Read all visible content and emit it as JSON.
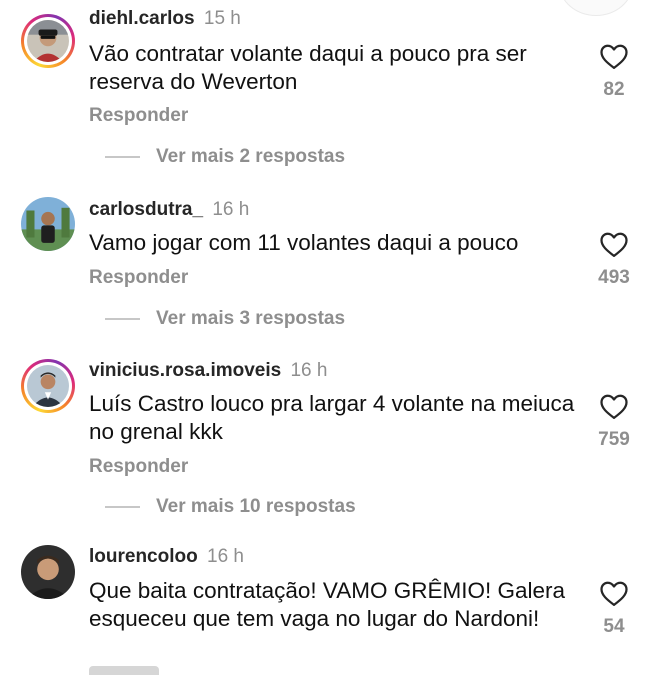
{
  "comments": [
    {
      "username": "diehl.carlos",
      "time": "15 h",
      "text": "Vão contratar volante daqui a pouco pra ser reserva do Weverton",
      "likes": "82",
      "reply_label": "Responder",
      "more_replies": "Ver mais 2 respostas",
      "has_story_ring": true
    },
    {
      "username": "carlosdutra_",
      "time": "16 h",
      "text": "Vamo jogar com 11 volantes daqui a pouco",
      "likes": "493",
      "reply_label": "Responder",
      "more_replies": "Ver mais 3 respostas",
      "has_story_ring": false
    },
    {
      "username": "vinicius.rosa.imoveis",
      "time": "16 h",
      "text": "Luís Castro louco pra largar 4 volante na meiuca no grenal kkk",
      "likes": "759",
      "reply_label": "Responder",
      "more_replies": "Ver mais 10 respostas",
      "has_story_ring": true
    },
    {
      "username": "lourencoloo",
      "time": "16 h",
      "text": "Que baita contratação! VAMO GRÊMIO! Galera esqueceu que tem vaga no lugar do Nardoni!",
      "likes": "54",
      "has_story_ring": false
    }
  ],
  "icons": {
    "like": "heart-outline-icon"
  },
  "colors": {
    "username": "#262626",
    "secondary_text": "#8e8e8e",
    "story_ring_start": "#fdd835",
    "story_ring_end": "#dd2a7b"
  }
}
